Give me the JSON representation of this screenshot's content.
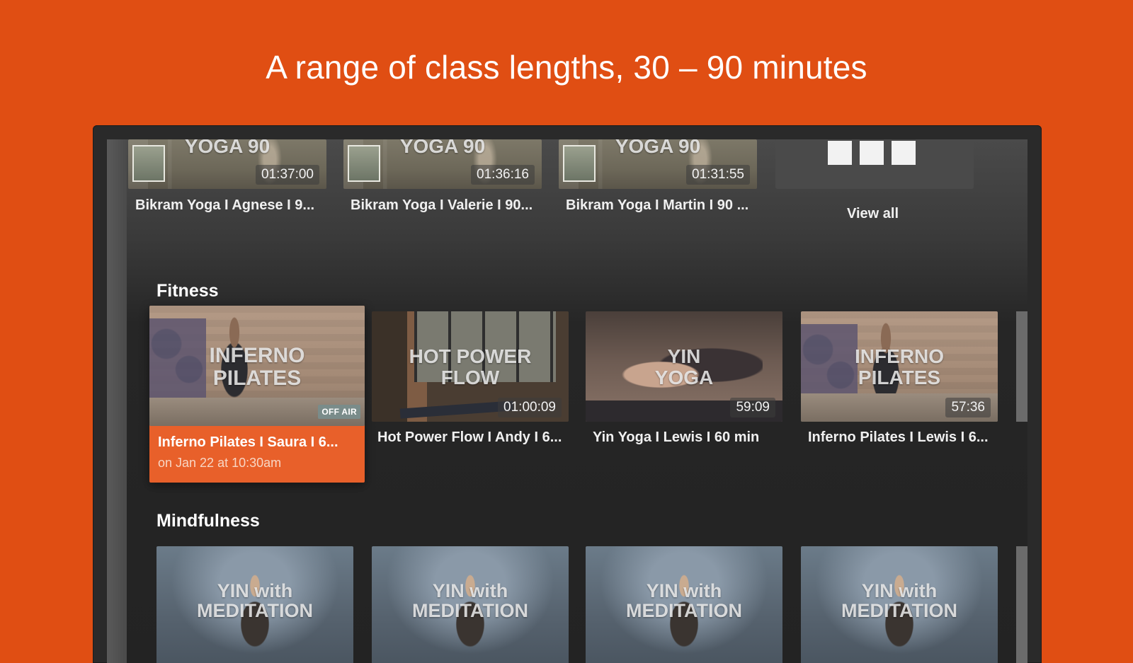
{
  "headline": "A range of class lengths, 30 – 90 minutes",
  "top_row": {
    "items": [
      {
        "thumb_title": "YOGA 90",
        "duration": "01:37:00",
        "label": "Bikram Yoga I Agnese I 9..."
      },
      {
        "thumb_title": "YOGA 90",
        "duration": "01:36:16",
        "label": "Bikram Yoga I Valerie I 90..."
      },
      {
        "thumb_title": "YOGA 90",
        "duration": "01:31:55",
        "label": "Bikram Yoga I Martin I 90 ..."
      }
    ],
    "view_all_label": "View all"
  },
  "fitness": {
    "title": "Fitness",
    "focused": {
      "thumb_title_line1": "INFERNO",
      "thumb_title_line2": "PILATES",
      "badge": "OFF AIR",
      "label": "Inferno Pilates I Saura I 6...",
      "sub": "on Jan 22 at 10:30am"
    },
    "items": [
      {
        "thumb_title_line1": "HOT POWER",
        "thumb_title_line2": "FLOW",
        "duration": "01:00:09",
        "label": "Hot Power Flow I Andy I 6..."
      },
      {
        "thumb_title_line1": "YIN",
        "thumb_title_line2": "YOGA",
        "duration": "59:09",
        "label": "Yin Yoga I Lewis I 60 min"
      },
      {
        "thumb_title_line1": "INFERNO",
        "thumb_title_line2": "PILATES",
        "duration": "57:36",
        "label": "Inferno Pilates I Lewis I 6..."
      }
    ]
  },
  "mindfulness": {
    "title": "Mindfulness",
    "items": [
      {
        "thumb_title_line1": "YIN with",
        "thumb_title_line2": "MEDITATION"
      },
      {
        "thumb_title_line1": "YIN with",
        "thumb_title_line2": "MEDITATION"
      },
      {
        "thumb_title_line1": "YIN with",
        "thumb_title_line2": "MEDITATION"
      },
      {
        "thumb_title_line1": "YIN with",
        "thumb_title_line2": "MEDITATION"
      }
    ]
  },
  "colors": {
    "background": "#e04e13",
    "focus_accent": "#e8602a",
    "screen": "#232323"
  },
  "icons": {
    "view_all": "grid-icon"
  }
}
